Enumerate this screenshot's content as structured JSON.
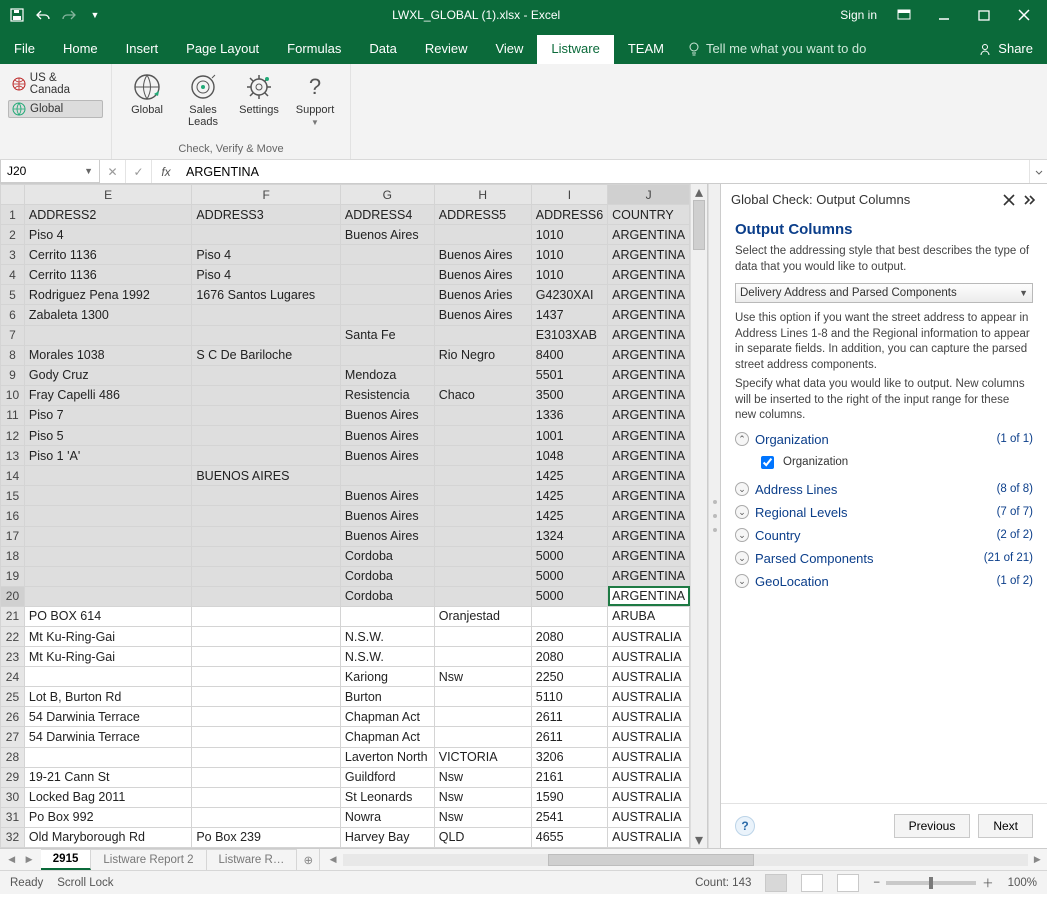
{
  "title": "LWXL_GLOBAL (1).xlsx  -  Excel",
  "signin": "Sign in",
  "menu": {
    "file": "File",
    "tabs": [
      "Home",
      "Insert",
      "Page Layout",
      "Formulas",
      "Data",
      "Review",
      "View",
      "Listware",
      "TEAM"
    ],
    "active": "Listware",
    "tell_placeholder": "Tell me what you want to do",
    "share": "Share"
  },
  "ribbon": {
    "side": {
      "us": "US & Canada",
      "global": "Global"
    },
    "global": "Global",
    "sales": "Sales Leads",
    "settings": "Settings",
    "support": "Support",
    "group_caption": "Check, Verify & Move"
  },
  "fxbar": {
    "cell": "J20",
    "fx": "fx",
    "value": "ARGENTINA"
  },
  "grid": {
    "cols": [
      "E",
      "F",
      "G",
      "H",
      "I",
      "J"
    ],
    "headers": [
      "ADDRESS2",
      "ADDRESS3",
      "ADDRESS4",
      "ADDRESS5",
      "ADDRESS6",
      "COUNTRY"
    ],
    "active": {
      "row": 20,
      "colIndex": 5
    },
    "selEnd": 20,
    "rows": [
      {
        "n": 1,
        "c": [
          "ADDRESS2",
          "ADDRESS3",
          "ADDRESS4",
          "ADDRESS5",
          "ADDRESS6",
          "COUNTRY"
        ]
      },
      {
        "n": 2,
        "c": [
          "Piso 4",
          "",
          "Buenos Aires",
          "",
          "1010",
          "ARGENTINA"
        ]
      },
      {
        "n": 3,
        "c": [
          "Cerrito 1136",
          "Piso 4",
          "",
          "Buenos Aires",
          "1010",
          "ARGENTINA"
        ]
      },
      {
        "n": 4,
        "c": [
          "Cerrito 1136",
          "Piso 4",
          "",
          "Buenos Aires",
          "1010",
          "ARGENTINA"
        ]
      },
      {
        "n": 5,
        "c": [
          "Rodriguez Pena 1992",
          "1676 Santos Lugares",
          "",
          "Buenos Aries",
          "G4230XAI",
          "ARGENTINA"
        ]
      },
      {
        "n": 6,
        "c": [
          "Zabaleta 1300",
          "",
          "",
          "Buenos Aires",
          "1437",
          "ARGENTINA"
        ]
      },
      {
        "n": 7,
        "c": [
          "",
          "",
          "Santa Fe",
          "",
          "E3103XAB",
          "ARGENTINA"
        ]
      },
      {
        "n": 8,
        "c": [
          "Morales 1038",
          "S C De Bariloche",
          "",
          "Rio Negro",
          "8400",
          "ARGENTINA"
        ]
      },
      {
        "n": 9,
        "c": [
          "Gody Cruz",
          "",
          "Mendoza",
          "",
          "5501",
          "ARGENTINA"
        ]
      },
      {
        "n": 10,
        "c": [
          "Fray Capelli 486",
          "",
          "Resistencia",
          "Chaco",
          "3500",
          "ARGENTINA"
        ]
      },
      {
        "n": 11,
        "c": [
          "Piso 7",
          "",
          "Buenos Aires",
          "",
          "1336",
          "ARGENTINA"
        ]
      },
      {
        "n": 12,
        "c": [
          "Piso 5",
          "",
          "Buenos Aires",
          "",
          "1001",
          "ARGENTINA"
        ]
      },
      {
        "n": 13,
        "c": [
          "Piso 1 'A'",
          "",
          "Buenos Aires",
          "",
          "1048",
          "ARGENTINA"
        ]
      },
      {
        "n": 14,
        "c": [
          "",
          "BUENOS AIRES",
          "",
          "",
          "1425",
          "ARGENTINA"
        ]
      },
      {
        "n": 15,
        "c": [
          "",
          "",
          "Buenos Aires",
          "",
          "1425",
          "ARGENTINA"
        ]
      },
      {
        "n": 16,
        "c": [
          "",
          "",
          "Buenos Aires",
          "",
          "1425",
          "ARGENTINA"
        ]
      },
      {
        "n": 17,
        "c": [
          "",
          "",
          "Buenos Aires",
          "",
          "1324",
          "ARGENTINA"
        ]
      },
      {
        "n": 18,
        "c": [
          "",
          "",
          "Cordoba",
          "",
          "5000",
          "ARGENTINA"
        ]
      },
      {
        "n": 19,
        "c": [
          "",
          "",
          "Cordoba",
          "",
          "5000",
          "ARGENTINA"
        ]
      },
      {
        "n": 20,
        "c": [
          "",
          "",
          "Cordoba",
          "",
          "5000",
          "ARGENTINA"
        ]
      },
      {
        "n": 21,
        "c": [
          "PO BOX 614",
          "",
          "",
          "Oranjestad",
          "",
          "ARUBA"
        ]
      },
      {
        "n": 22,
        "c": [
          "Mt Ku-Ring-Gai",
          "",
          "N.S.W.",
          "",
          "2080",
          "AUSTRALIA"
        ]
      },
      {
        "n": 23,
        "c": [
          "Mt Ku-Ring-Gai",
          "",
          "N.S.W.",
          "",
          "2080",
          "AUSTRALIA"
        ]
      },
      {
        "n": 24,
        "c": [
          "",
          "",
          "Kariong",
          "Nsw",
          "2250",
          "AUSTRALIA"
        ]
      },
      {
        "n": 25,
        "c": [
          "Lot B, Burton Rd",
          "",
          "Burton",
          "",
          "5110",
          "AUSTRALIA"
        ]
      },
      {
        "n": 26,
        "c": [
          "54 Darwinia Terrace",
          "",
          "Chapman Act",
          "",
          "2611",
          "AUSTRALIA"
        ]
      },
      {
        "n": 27,
        "c": [
          "54 Darwinia Terrace",
          "",
          "Chapman Act",
          "",
          "2611",
          "AUSTRALIA"
        ]
      },
      {
        "n": 28,
        "c": [
          "",
          "",
          "Laverton North",
          "VICTORIA",
          "3206",
          "AUSTRALIA"
        ]
      },
      {
        "n": 29,
        "c": [
          "19-21 Cann St",
          "",
          "Guildford",
          "Nsw",
          "2161",
          "AUSTRALIA"
        ]
      },
      {
        "n": 30,
        "c": [
          "Locked Bag 2011",
          "",
          "St Leonards",
          "Nsw",
          "1590",
          "AUSTRALIA"
        ]
      },
      {
        "n": 31,
        "c": [
          "Po Box 992",
          "",
          "Nowra",
          "Nsw",
          "2541",
          "AUSTRALIA"
        ]
      },
      {
        "n": 32,
        "c": [
          "Old Maryborough Rd",
          "Po Box 239",
          "Harvey Bay",
          "QLD",
          "4655",
          "AUSTRALIA"
        ]
      }
    ]
  },
  "sheets": {
    "active": "2915",
    "tabs": [
      "2915",
      "Listware Report 2",
      "Listware R…"
    ]
  },
  "panel": {
    "title": "Global Check: Output Columns",
    "heading": "Output Columns",
    "intro": "Select the addressing style that best describes the type of data that you would like to output.",
    "dropdown": "Delivery Address and Parsed Components",
    "desc": "Use this option if you want the street address to appear in Address Lines 1-8 and the Regional information to appear in separate fields. In addition, you can capture the parsed street address components.",
    "prompt": "Specify what data you would like to output. New columns will be inserted to the right of the input range for these new columns.",
    "cats": [
      {
        "name": "Organization",
        "count": "(1 of 1)",
        "open": true,
        "child": "Organization"
      },
      {
        "name": "Address Lines",
        "count": "(8 of 8)"
      },
      {
        "name": "Regional Levels",
        "count": "(7 of 7)"
      },
      {
        "name": "Country",
        "count": "(2 of 2)"
      },
      {
        "name": "Parsed Components",
        "count": "(21 of 21)"
      },
      {
        "name": "GeoLocation",
        "count": "(1 of 2)"
      }
    ],
    "prev": "Previous",
    "next": "Next"
  },
  "status": {
    "ready": "Ready",
    "scroll": "Scroll Lock",
    "count": "Count: 143",
    "zoom": "100%"
  }
}
